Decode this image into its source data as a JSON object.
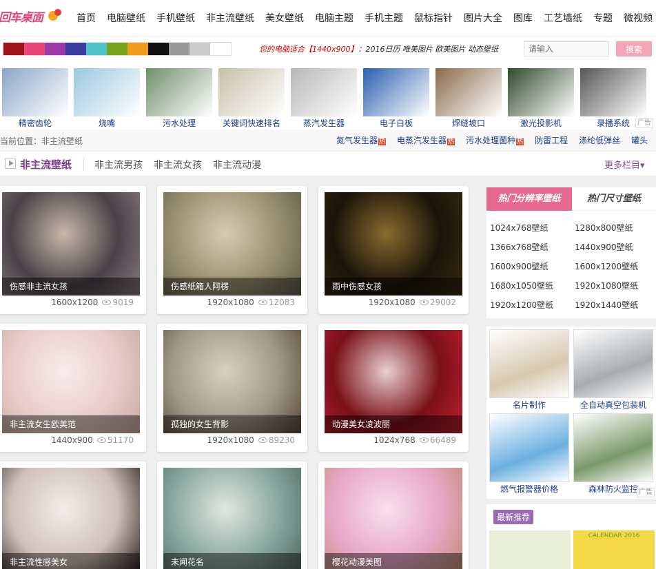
{
  "header": {
    "logo_text": "回车桌面",
    "nav": [
      "首页",
      "电脑壁纸",
      "手机壁纸",
      "非主流壁纸",
      "美女壁纸",
      "电脑主题",
      "手机主题",
      "鼠标指针",
      "图片大全",
      "图库",
      "工艺墙纸",
      "专题",
      "微视频"
    ]
  },
  "toolbar": {
    "swatches": [
      "#a0151b",
      "#e8457a",
      "#9b3aa8",
      "#3b3da0",
      "#4fc3c8",
      "#7aa41e",
      "#f29b1c",
      "#111111",
      "#999999",
      "#cccccc",
      "#ffffff"
    ],
    "promo_prefix": "您的电脑适合【1440x900】：",
    "promo_links": "2016日历  唯美图片  欧美图片  动态壁纸",
    "search_placeholder": "请输入",
    "search_button": "搜索"
  },
  "ad_strip": {
    "items": [
      {
        "label": "精密齿轮",
        "color": "#8aa6c8"
      },
      {
        "label": "烧嘴",
        "color": "#9bc8e0"
      },
      {
        "label": "污水处理",
        "color": "#6f8f6a"
      },
      {
        "label": "关键词快速排名",
        "color": "#c8c0a8"
      },
      {
        "label": "蒸汽发生器",
        "color": "#b8b8b8"
      },
      {
        "label": "电子白板",
        "color": "#2a5fb0"
      },
      {
        "label": "焊缝坡口",
        "color": "#8a6a4a"
      },
      {
        "label": "激光投影机",
        "color": "#2e4a2a"
      },
      {
        "label": "录播系统",
        "color": "#555555"
      }
    ],
    "ad_tag": "广告"
  },
  "breadcrumb": {
    "text": "当前位置：非主流壁纸",
    "links": [
      "氮气发生器",
      "电蒸汽发生器",
      "污水处理菌种",
      "防雷工程",
      "涤纶低弹丝",
      "罐头"
    ],
    "hot_badge": "热"
  },
  "category": {
    "title": "非主流壁纸",
    "tabs": [
      "非主流男孩",
      "非主流女孩",
      "非主流动漫"
    ],
    "more": "更多栏目▾"
  },
  "cards": [
    {
      "title": "伤感非主流女孩",
      "size": "1600x1200",
      "views": "9019",
      "colors": [
        "#4a4248",
        "#c9b7a8",
        "#8a7a80"
      ]
    },
    {
      "title": "伤感纸箱人阿楞",
      "size": "1920x1080",
      "views": "12083",
      "colors": [
        "#9a9070",
        "#d8ccb0",
        "#5a5a48"
      ]
    },
    {
      "title": "雨中伤感女孩",
      "size": "1920x1080",
      "views": "29002",
      "colors": [
        "#1a1408",
        "#8a6a30",
        "#3a2a10"
      ]
    },
    {
      "title": "非主流女生欧美范",
      "size": "1440x900",
      "views": "51170",
      "colors": [
        "#e8ccc8",
        "#f8ecec",
        "#c8a8a0"
      ]
    },
    {
      "title": "孤独的女生背影",
      "size": "1920x1080",
      "views": "89230",
      "colors": [
        "#a09888",
        "#d8d0c0",
        "#584838"
      ]
    },
    {
      "title": "动漫美女凌波丽",
      "size": "1024x768",
      "views": "66489",
      "colors": [
        "#7a1018",
        "#e8d0d0",
        "#c02030"
      ]
    },
    {
      "title": "非主流性感美女",
      "size": "",
      "views": "",
      "colors": [
        "#d0c0b8",
        "#f4ecea",
        "#2a2020"
      ]
    },
    {
      "title": "未闻花名",
      "size": "",
      "views": "",
      "colors": [
        "#8aa8a0",
        "#e0e8e0",
        "#506860"
      ]
    },
    {
      "title": "樱花动漫美图",
      "size": "",
      "views": "",
      "colors": [
        "#e8a8c8",
        "#f8e0ec",
        "#c08a70"
      ]
    }
  ],
  "sidebar": {
    "tab_res": "热门分辨率壁纸",
    "tab_size": "热门尺寸壁纸",
    "resolutions": [
      "1024x768壁纸",
      "1280x800壁纸",
      "1366x768壁纸",
      "1440x900壁纸",
      "1600x900壁纸",
      "1600x1200壁纸",
      "1680x1050壁纸",
      "1920x1080壁纸",
      "1920x1200壁纸",
      "1920x1440壁纸"
    ],
    "ads": [
      {
        "label": "名片制作",
        "color": "#d8c8b0"
      },
      {
        "label": "全自动真空包装机",
        "color": "#a8acb0"
      },
      {
        "label": "燃气报警器价格",
        "color": "#6ab0e0"
      },
      {
        "label": "森林防火监控",
        "color": "#7a9a6a"
      }
    ],
    "ad_tag": "广告",
    "new_title": "最新推荐",
    "new_items": [
      {
        "label": "",
        "color": "#e8eed8"
      },
      {
        "label": "CALENDAR 2016",
        "color": "#f4d848"
      }
    ]
  }
}
